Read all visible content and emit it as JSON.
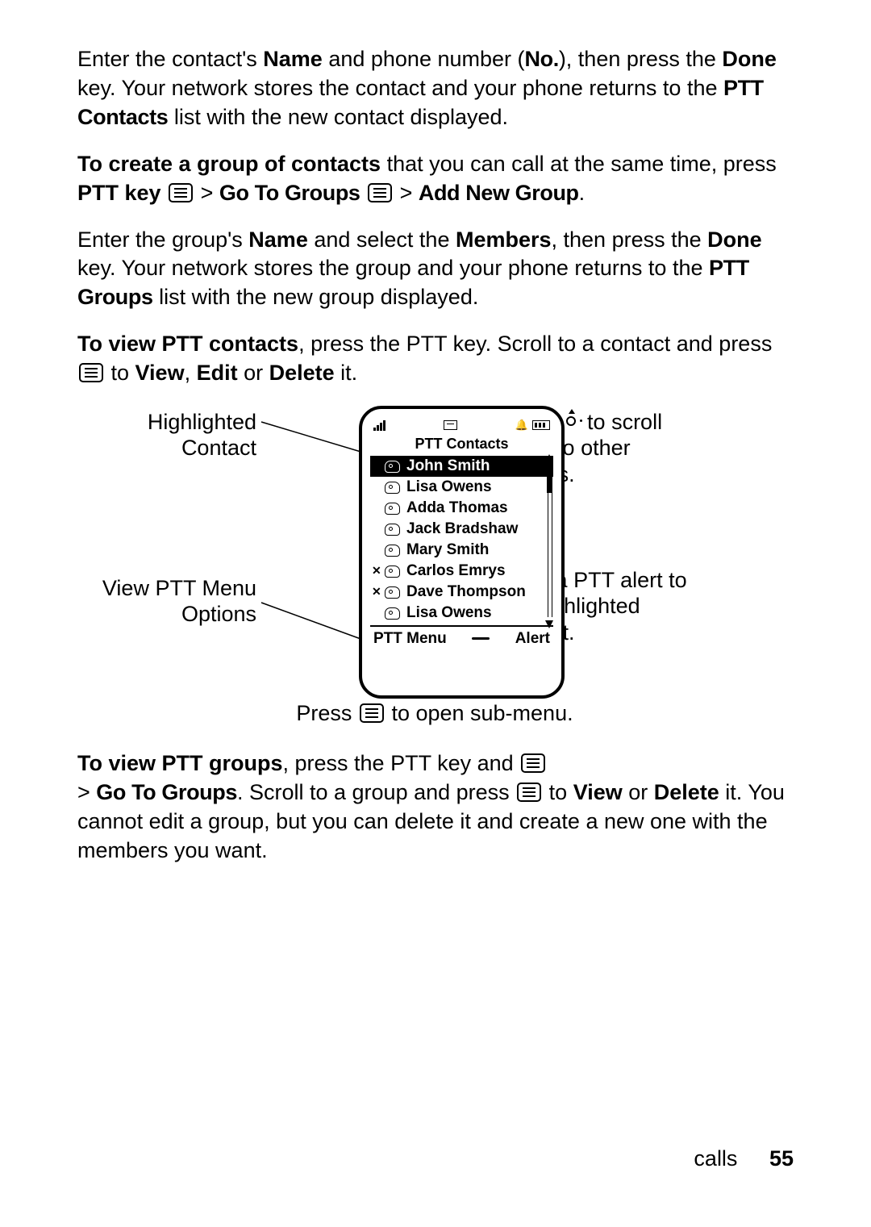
{
  "para1": {
    "t1": "Enter the contact's ",
    "b1": "Name",
    "t2": " and phone number (",
    "b2": "No.",
    "t3": "), then press the ",
    "b3": "Done",
    "t4": " key. Your network stores the contact and your phone returns to the ",
    "b4": "PTT Contacts",
    "t5": " list with the new contact displayed."
  },
  "para2": {
    "b1": "To create a group of contacts",
    "t1": " that you can call at the same time, press ",
    "b2": "PTT key",
    "sep1": " > ",
    "b3": "Go To Groups",
    "sep2": " > ",
    "b4": "Add New Group",
    "t2": "."
  },
  "para3": {
    "t1": "Enter the group's ",
    "b1": "Name",
    "t2": " and select the ",
    "b2": "Members",
    "t3": ", then press the ",
    "b3": "Done",
    "t4": " key. Your network stores the group and your phone returns to the ",
    "b4": "PTT Groups",
    "t5": " list with the new group displayed."
  },
  "para4": {
    "b1": "To view PTT contacts",
    "t1": ", press the PTT key. Scroll to a contact and press ",
    "t2": " to ",
    "b2": "View",
    "t3": ", ",
    "b3": "Edit",
    "t4": " or ",
    "b4": "Delete",
    "t5": " it."
  },
  "diagram": {
    "labels": {
      "highlighted": "Highlighted Contact",
      "viewmenu": "View PTT Menu Options",
      "scroll": "Press          to scroll down to other options.",
      "scroll_pre": "Press ",
      "scroll_post": " to scroll down to other options.",
      "alert": "Send a PTT alert to the highlighted contact.",
      "submenu_pre": "Press ",
      "submenu_post": " to open sub-menu."
    },
    "screen": {
      "title": "PTT Contacts",
      "contacts": [
        {
          "name": "John Smith",
          "hl": true,
          "x": false
        },
        {
          "name": "Lisa Owens",
          "hl": false,
          "x": false
        },
        {
          "name": "Adda Thomas",
          "hl": false,
          "x": false
        },
        {
          "name": "Jack Bradshaw",
          "hl": false,
          "x": false
        },
        {
          "name": "Mary Smith",
          "hl": false,
          "x": false
        },
        {
          "name": "Carlos Emrys",
          "hl": false,
          "x": true
        },
        {
          "name": "Dave Thompson",
          "hl": false,
          "x": true
        },
        {
          "name": "Lisa Owens",
          "hl": false,
          "x": false
        }
      ],
      "soft_left": "PTT Menu",
      "soft_right": "Alert"
    }
  },
  "para5": {
    "b1": "To view PTT groups",
    "t1": ", press the PTT key and ",
    "sep1": "> ",
    "b2": "Go To Groups",
    "t2": ". Scroll to a group and press ",
    "t3": " to ",
    "b3": "View",
    "t4": " or ",
    "b4": "Delete",
    "t5": " it. You cannot edit a group, but you can delete it and create a new one with the members you want."
  },
  "footer": {
    "section": "calls",
    "page": "55"
  }
}
